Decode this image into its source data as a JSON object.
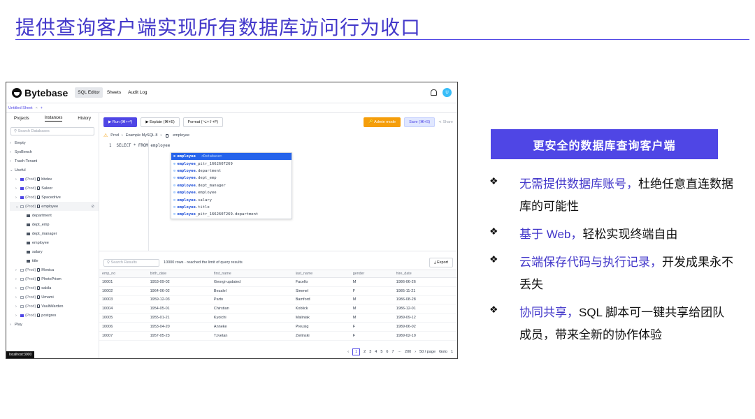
{
  "slide": {
    "title": "提供查询客户端实现所有数据库访问行为收口",
    "banner": "更安全的数据库查询客户端",
    "bullet_mark": "❖",
    "bullets": [
      {
        "highlight": "无需提供数据库账号，",
        "rest": "杜绝任意直连数据库的可能性"
      },
      {
        "highlight": "基于 Web，",
        "rest": "轻松实现终端自由"
      },
      {
        "highlight": "云端保存代码与执行记录，",
        "rest": "开发成果永不丢失"
      },
      {
        "highlight": "协同共享，",
        "rest": "SQL 脚本可一键共享给团队成员，带来全新的协作体验"
      }
    ]
  },
  "app": {
    "brand": "Bytebase",
    "nav": [
      "SQL Editor",
      "Sheets",
      "Audit Log"
    ],
    "avatar_initial": "U",
    "sheet_tab": "Untitled Sheet",
    "sheet_close": "×",
    "sheet_add": "+",
    "sidebar_tabs": [
      "Projects",
      "Instances",
      "History"
    ],
    "sidebar_search_placeholder": "Search Databases",
    "tree_top": [
      "Empty",
      "SysBench",
      "Trash-Tenant",
      "Useful"
    ],
    "useful_dbs": [
      {
        "env": "(Prod)",
        "name": "bbdev"
      },
      {
        "env": "(Prod)",
        "name": "Saleor"
      },
      {
        "env": "(Prod)",
        "name": "Spacedrive"
      },
      {
        "env": "(Prod)",
        "name": "employee"
      }
    ],
    "employee_tables": [
      "department",
      "dept_emp",
      "dept_manager",
      "employee",
      "salary",
      "title"
    ],
    "more_dbs": [
      {
        "env": "(Prod)",
        "name": "Monica"
      },
      {
        "env": "(Prod)",
        "name": "PhotoPrism"
      },
      {
        "env": "(Prod)",
        "name": "sakila"
      },
      {
        "env": "(Prod)",
        "name": "Umami"
      },
      {
        "env": "(Prod)",
        "name": "VaultWarden"
      },
      {
        "env": "(Prod)",
        "name": "postgres"
      }
    ],
    "tree_bottom": "Play",
    "toolbar": {
      "run": "▶ Run (⌘+⏎)",
      "explain": "▶ Explain (⌘+E)",
      "format": "Format (⌥+⇧+F)",
      "admin": "🔑 Admin mode",
      "save": "Save (⌘+S)",
      "share": "Share"
    },
    "breadcrumb": {
      "env": "Prod",
      "instance": "Example MySQL 8",
      "database": "employee"
    },
    "editor_line_no": "1",
    "editor_code": "SELECT * FROM employee",
    "autocomplete": [
      {
        "name": "employee",
        "hint": "<Database>"
      },
      {
        "name": "employee",
        "rest": "_pitr_1662607269"
      },
      {
        "name": "employee",
        "rest": ".department"
      },
      {
        "name": "employee",
        "rest": ".dept_emp"
      },
      {
        "name": "employee",
        "rest": ".dept_manager"
      },
      {
        "name": "employee",
        "rest": ".employee"
      },
      {
        "name": "employee",
        "rest": ".salary"
      },
      {
        "name": "employee",
        "rest": ".title"
      },
      {
        "name": "employee",
        "rest": "_pitr_1662607269.department"
      }
    ],
    "results": {
      "search_placeholder": "Search Results",
      "info": "10000 rows  ·  reached the limit of query results",
      "export": "Export",
      "columns": [
        "emp_no",
        "birth_date",
        "first_name",
        "last_name",
        "gender",
        "hire_date"
      ],
      "rows": [
        [
          "10001",
          "1953-09-02",
          "Georgi-updated",
          "Facello",
          "M",
          "1986-06-26"
        ],
        [
          "10002",
          "1964-06-02",
          "Bezalel",
          "Simmel",
          "F",
          "1985-11-21"
        ],
        [
          "10003",
          "1959-12-03",
          "Parto",
          "Bamford",
          "M",
          "1986-08-28"
        ],
        [
          "10004",
          "1954-05-01",
          "Chirstian",
          "Koblick",
          "M",
          "1986-12-01"
        ],
        [
          "10005",
          "1955-01-21",
          "Kyoichi",
          "Maliniak",
          "M",
          "1989-09-12"
        ],
        [
          "10006",
          "1953-04-20",
          "Anneke",
          "Preusig",
          "F",
          "1989-06-02"
        ],
        [
          "10007",
          "1957-05-23",
          "Tzvetan",
          "Zielinski",
          "F",
          "1989-02-10"
        ]
      ]
    },
    "pager": {
      "pages": [
        "1",
        "2",
        "3",
        "4",
        "5",
        "6",
        "7",
        "···",
        "200"
      ],
      "page_size": "50 / page",
      "goto_label": "Goto",
      "goto_value": "1"
    },
    "statusbar": "localhost:3000"
  }
}
